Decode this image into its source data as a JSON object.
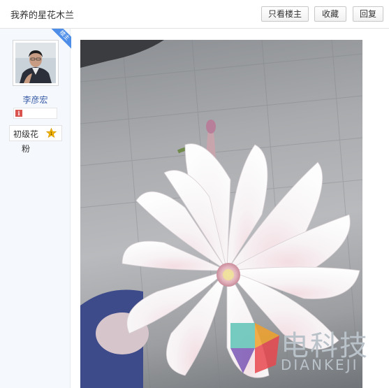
{
  "header": {
    "title": "我养的星花木兰",
    "only_op_label": "只看楼主",
    "favorite_label": "收藏",
    "reply_label": "回复"
  },
  "profile": {
    "badge_label": "楼主",
    "username": "李彦宏",
    "info_icon": "i",
    "level_name": "初级花",
    "level_number": "1",
    "fan_label": "粉"
  },
  "photo": {
    "subject": "star-magnolia-flower-icon"
  },
  "watermark": {
    "cn": "电科技",
    "en": "DIANKEJI"
  },
  "colors": {
    "link_blue": "#3b5ea8",
    "ribbon_blue": "#4e8ee8",
    "level_badge": "#f0b400",
    "info_red": "#d9534f"
  }
}
